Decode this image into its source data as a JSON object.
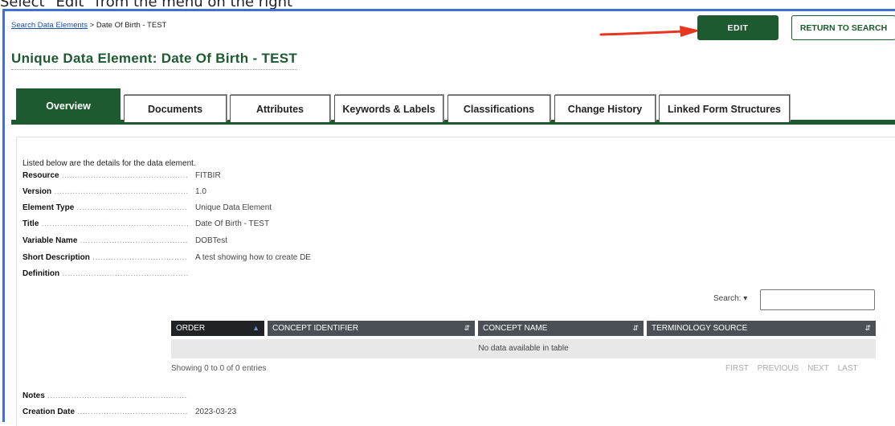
{
  "caption": "Select \"Edit\" from the menu on the right",
  "breadcrumb": {
    "link": "Search Data Elements",
    "separator": " > ",
    "current": "Date Of Birth - TEST"
  },
  "buttons": {
    "edit": "EDIT",
    "return_to_search": "RETURN TO SEARCH"
  },
  "page_title": "Unique Data Element: Date Of Birth - TEST",
  "tabs": [
    {
      "label": "Overview",
      "active": true
    },
    {
      "label": "Documents"
    },
    {
      "label": "Attributes"
    },
    {
      "label": "Keywords & Labels"
    },
    {
      "label": "Classifications"
    },
    {
      "label": "Change History"
    },
    {
      "label": "Linked Form Structures"
    }
  ],
  "intro_text": "Listed below are the details for the data element.",
  "fields": [
    {
      "label": "Resource",
      "value": "FITBIR"
    },
    {
      "label": "Version",
      "value": "1.0"
    },
    {
      "label": "Element Type",
      "value": "Unique Data Element"
    },
    {
      "label": "Title",
      "value": "Date Of Birth - TEST"
    },
    {
      "label": "Variable Name",
      "value": "DOBTest"
    },
    {
      "label": "Short Description",
      "value": "A test showing how to create DE"
    },
    {
      "label": "Definition",
      "value": ""
    }
  ],
  "search": {
    "label": "Search:",
    "value": ""
  },
  "table": {
    "columns": [
      "ORDER",
      "CONCEPT IDENTIFIER",
      "CONCEPT NAME",
      "TERMINOLOGY SOURCE"
    ],
    "empty_message": "No data available in table",
    "entries_info": "Showing 0 to 0 of 0 entries",
    "pager": [
      "FIRST",
      "PREVIOUS",
      "NEXT",
      "LAST"
    ]
  },
  "bottom_fields": [
    {
      "label": "Notes",
      "value": ""
    },
    {
      "label": "Creation Date",
      "value": "2023-03-23"
    }
  ],
  "colors": {
    "primary_green": "#1d5a2f",
    "frame_blue": "#3d6fd8",
    "arrow_red": "#e8371f",
    "table_header": "#4a5055"
  }
}
